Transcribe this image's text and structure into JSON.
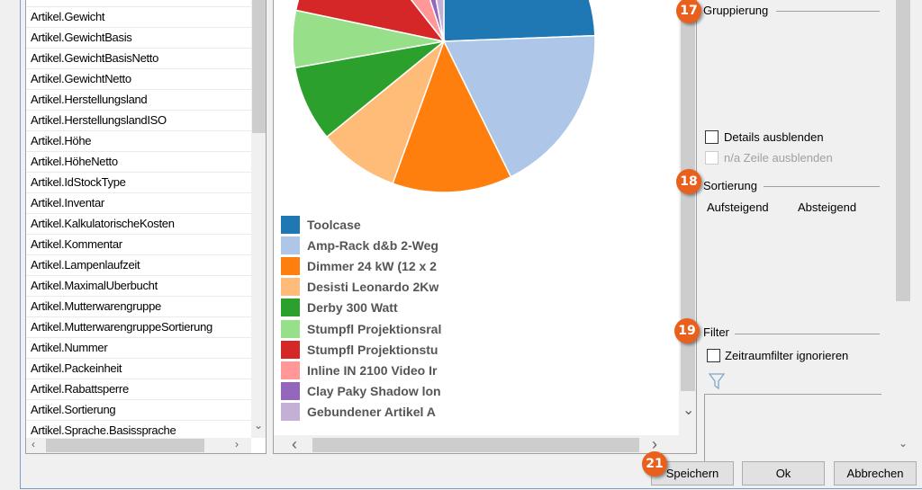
{
  "fields": [
    "Artikel.Gewicht",
    "Artikel.GewichtBasis",
    "Artikel.GewichtBasisNetto",
    "Artikel.GewichtNetto",
    "Artikel.Herstellungsland",
    "Artikel.HerstellungslandISO",
    "Artikel.Höhe",
    "Artikel.HöheNetto",
    "Artikel.IdStockType",
    "Artikel.Inventar",
    "Artikel.KalkulatorischeKosten",
    "Artikel.Kommentar",
    "Artikel.Lampenlaufzeit",
    "Artikel.MaximalUberbucht",
    "Artikel.Mutterwarengruppe",
    "Artikel.MutterwarengruppeSortierung",
    "Artikel.Nummer",
    "Artikel.Packeinheit",
    "Artikel.Rabattsperre",
    "Artikel.Sortierung",
    "Artikel.Sprache.Basissprache"
  ],
  "chart_data": {
    "type": "pie",
    "unit": "percent (estimated)",
    "categories": [
      "Toolcase",
      "Amp-Rack d&b 2-Weg",
      "Dimmer 24 kW (12 x 2",
      "Desisti Leonardo 2Kw",
      "Derby 300 Watt",
      "Stumpfl Projektionsral",
      "Stumpfl Projektionstu",
      "Inline IN 2100 Video Ir",
      "Clay Paky Shadow lon",
      "Gebundener Artikel A"
    ],
    "values": [
      24.4,
      18.3,
      12.8,
      8.6,
      8.1,
      6.1,
      11.1,
      5.5,
      2.2,
      2.9
    ],
    "colors": [
      "#1f77b4",
      "#aec7e8",
      "#ff7f0e",
      "#ffbb78",
      "#2ca02c",
      "#98df8a",
      "#d62728",
      "#ff9896",
      "#9467bd",
      "#c5b0d5"
    ],
    "legend": "bottom-left"
  },
  "right": {
    "grouping": "Gruppierung",
    "hide_details": "Details ausblenden",
    "hide_na": "n/a Zeile ausblenden",
    "sorting": "Sortierung",
    "asc": "Aufsteigend",
    "desc": "Absteigend",
    "filter": "Filter",
    "ignore_period": "Zeitraumfilter ignorieren"
  },
  "badges": {
    "b17": "17",
    "b18": "18",
    "b19": "19",
    "b21": "21"
  },
  "buttons": {
    "save": "Speichern",
    "ok": "Ok",
    "cancel": "Abbrechen"
  }
}
